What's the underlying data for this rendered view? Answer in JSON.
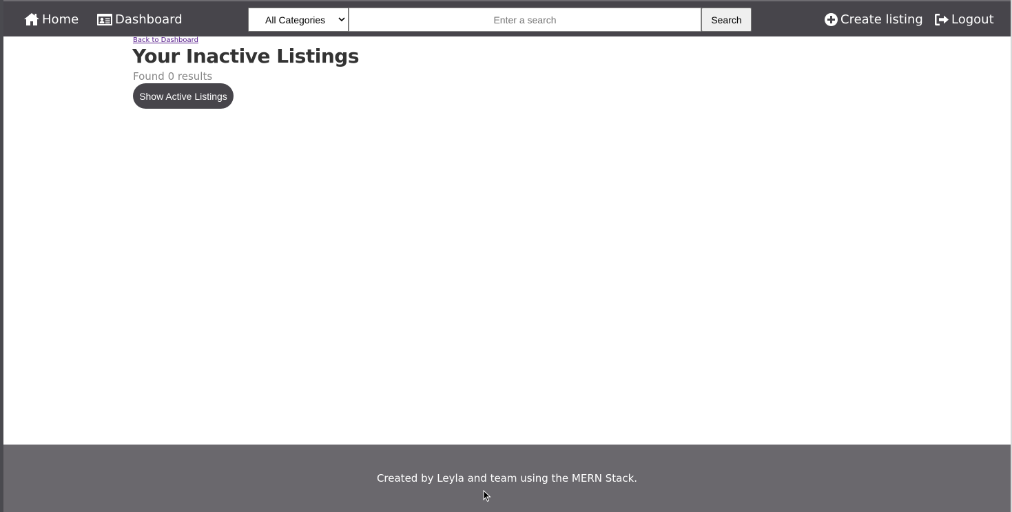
{
  "navbar": {
    "home_label": "Home",
    "home_icon": "home-icon",
    "dashboard_label": "Dashboard",
    "dashboard_icon": "id-card-icon",
    "category_select": {
      "selected": "All Categories"
    },
    "search": {
      "placeholder": "Enter a search",
      "value": ""
    },
    "search_button_label": "Search",
    "create_label": "Create listing",
    "create_icon": "plus-circle-icon",
    "logout_label": "Logout",
    "logout_icon": "sign-out-icon"
  },
  "main": {
    "back_link": "Back to Dashboard",
    "title": "Your Inactive Listings",
    "results": "Found 0 results",
    "toggle_button_label": "Show Active Listings"
  },
  "footer": {
    "text": "Created by Leyla and team using the MERN Stack."
  },
  "colors": {
    "navbar_bg": "#47454b",
    "footer_bg": "#6a686d",
    "button_bg": "#47454b",
    "title_color": "#333333",
    "link_color": "#551a8b"
  }
}
